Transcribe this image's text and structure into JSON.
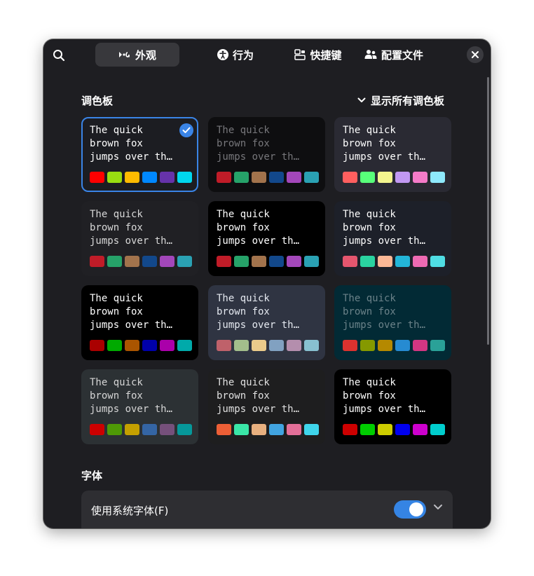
{
  "tabs": [
    {
      "label": "外观",
      "icon": "appearance-icon"
    },
    {
      "label": "行为",
      "icon": "accessibility-icon"
    },
    {
      "label": "快捷键",
      "icon": "shortcuts-icon"
    },
    {
      "label": "配置文件",
      "icon": "profiles-icon"
    }
  ],
  "palette": {
    "title": "调色板",
    "show_all": "显示所有调色板",
    "sample_lines": [
      "The quick",
      "brown fox",
      "jumps over th…"
    ],
    "cards": [
      {
        "bg": "#1c1d22",
        "fg": "#ffffff",
        "selected": true,
        "swatches": [
          "#ff0000",
          "#99dd11",
          "#ffbb00",
          "#0088ff",
          "#6633aa",
          "#00d7ee"
        ]
      },
      {
        "bg": "#0e0e10",
        "fg": "#77777b",
        "swatches": [
          "#c01c28",
          "#26a269",
          "#a2734c",
          "#12488b",
          "#a347ba",
          "#2aa1b3"
        ]
      },
      {
        "bg": "#2a2a33",
        "fg": "#ffffff",
        "swatches": [
          "#ff5f5f",
          "#58ff7a",
          "#f3f58e",
          "#c198f2",
          "#f57bc8",
          "#8ee9fc"
        ]
      },
      {
        "bg": "#202024",
        "fg": "#d8d8d8",
        "swatches": [
          "#c01c28",
          "#26a269",
          "#a2734c",
          "#12488b",
          "#a347ba",
          "#2aa1b3"
        ]
      },
      {
        "bg": "#000000",
        "fg": "#ffffff",
        "swatches": [
          "#c01c28",
          "#26a269",
          "#a2734c",
          "#12488b",
          "#a347ba",
          "#2aa1b3"
        ]
      },
      {
        "bg": "#1d2029",
        "fg": "#ffffff",
        "swatches": [
          "#e5566e",
          "#2ad3a0",
          "#fcb896",
          "#23b5d8",
          "#ee6ab3",
          "#4fdde3"
        ]
      },
      {
        "bg": "#000000",
        "fg": "#ffffff",
        "swatches": [
          "#aa0000",
          "#00aa00",
          "#aa5500",
          "#0000aa",
          "#aa00aa",
          "#00aaaa"
        ]
      },
      {
        "bg": "#2f3442",
        "fg": "#e5e9f0",
        "swatches": [
          "#bf616a",
          "#a3be8c",
          "#ebcb8b",
          "#81a1c1",
          "#b48ead",
          "#88c0d0"
        ]
      },
      {
        "bg": "#022a35",
        "fg": "#6b8289",
        "swatches": [
          "#dc322f",
          "#859900",
          "#b58900",
          "#268bd2",
          "#d33682",
          "#2aa198"
        ]
      },
      {
        "bg": "#2c3134",
        "fg": "#d6d6d6",
        "swatches": [
          "#cc0000",
          "#4e9a06",
          "#c4a000",
          "#3465a4",
          "#75507b",
          "#06989a"
        ]
      },
      {
        "bg": "#1e1e1f",
        "fg": "#e0e0e0",
        "swatches": [
          "#ed5f36",
          "#3ae6a7",
          "#e8b07f",
          "#41a4e0",
          "#e36f98",
          "#3fd5eb"
        ]
      },
      {
        "bg": "#000000",
        "fg": "#ffffff",
        "swatches": [
          "#cd0000",
          "#00cd00",
          "#cdcd00",
          "#0000ee",
          "#cd00cd",
          "#00cdcd"
        ]
      }
    ]
  },
  "font": {
    "title": "字体",
    "use_system_font": "使用系统字体(F)",
    "use_system_font_enabled": true
  },
  "colors": {
    "window_bg": "#1e1e22",
    "accent": "#3584e4"
  }
}
